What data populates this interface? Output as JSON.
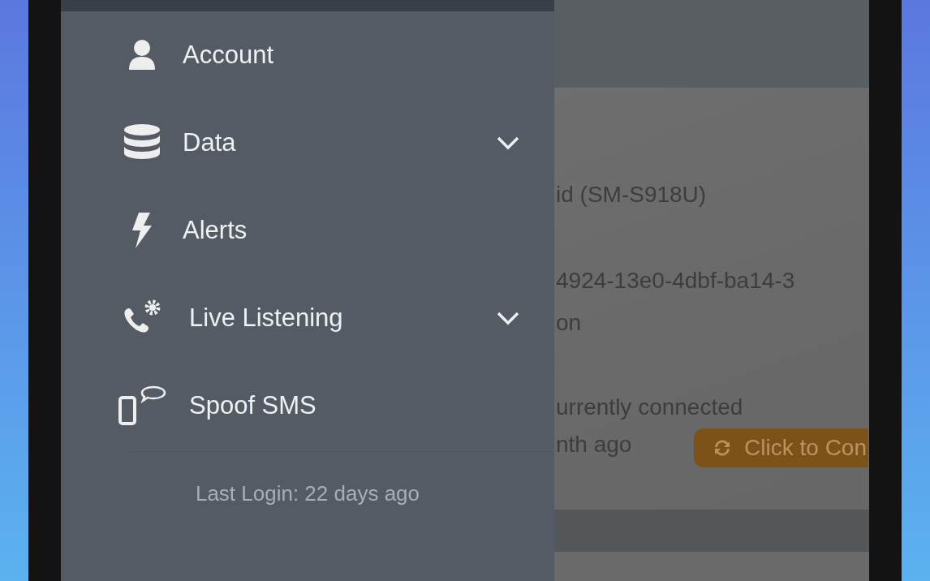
{
  "drawer": {
    "items": [
      {
        "label": "Account",
        "kind": "link"
      },
      {
        "label": "Data",
        "kind": "group",
        "expanded": false
      },
      {
        "label": "Alerts",
        "kind": "link"
      },
      {
        "label": "Live Listening",
        "kind": "group",
        "expanded": false
      },
      {
        "label": "Spoof SMS",
        "kind": "link"
      }
    ],
    "last_login": "Last Login: 22 days ago"
  },
  "background_card": {
    "lines": [
      "id (SM-S918U)",
      "4924-13e0-4dbf-ba14-3",
      "on",
      "urrently connected"
    ],
    "last_line": "nth ago",
    "button": "Click to Con"
  }
}
